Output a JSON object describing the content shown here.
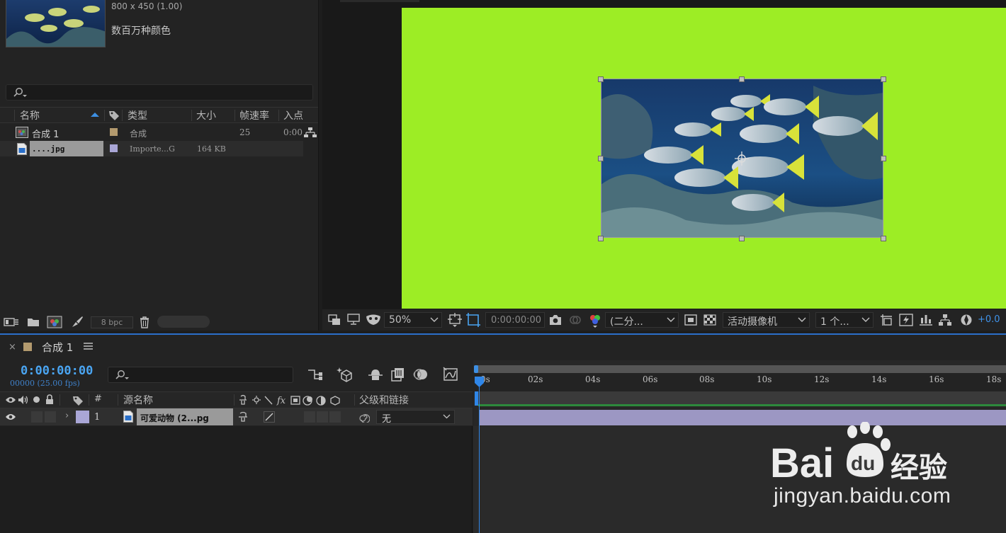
{
  "project": {
    "thumb_dims": "800 x 450 (1.00)",
    "thumb_colors": "数百万种颜色",
    "search_placeholder": "",
    "columns": {
      "name": "名称",
      "type": "类型",
      "size": "大小",
      "fps": "帧速率",
      "in": "入点"
    },
    "items": [
      {
        "name": "合成 1",
        "type": "合成",
        "size": "",
        "fps": "25",
        "in": "0:00",
        "label_color": "#b39a6e"
      },
      {
        "name": "....jpg",
        "type": "Importe...G",
        "size": "164 KB",
        "fps": "",
        "in": "",
        "label_color": "#a9a6d6"
      }
    ],
    "bpc_label": "8 bpc"
  },
  "viewer": {
    "canvas_color": "#9ded25",
    "toolbar": {
      "zoom": "50%",
      "timecode": "0:00:00:00",
      "resolution": "(二分...",
      "camera": "活动摄像机",
      "views": "1 个...",
      "exposure": "+0.0"
    }
  },
  "timeline": {
    "tab_label": "合成 1",
    "current_time": "0:00:00:00",
    "frames": "00000 (25.00 fps)",
    "columns": {
      "number": "#",
      "source_name": "源名称",
      "parent": "父级和链接"
    },
    "layer": {
      "number": "1",
      "name": "可爱动物 (2...pg",
      "parent_value": "无",
      "label_color": "#a9a6d6"
    },
    "ruler_ticks": [
      "0s",
      "02s",
      "04s",
      "06s",
      "08s",
      "10s",
      "12s",
      "14s",
      "16s",
      "18s"
    ]
  },
  "watermark": {
    "brand_latin_a": "Bai",
    "brand_latin_b": "du",
    "brand_cn": "经验",
    "url": "jingyan.baidu.com"
  },
  "colors": {
    "accent": "#4aa5f2",
    "track": "#9c97c3",
    "panel": "#232323"
  }
}
